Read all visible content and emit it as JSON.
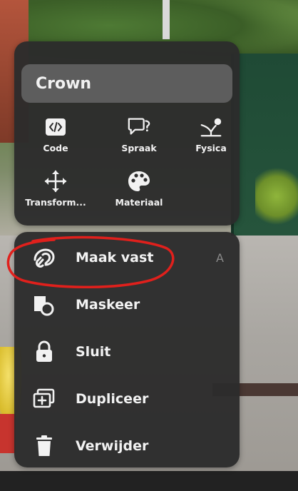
{
  "panel": {
    "title": "Crown"
  },
  "tools": [
    {
      "label": "Code",
      "icon": "code-icon"
    },
    {
      "label": "Spraak",
      "icon": "speech-bubble-icon"
    },
    {
      "label": "Fysica",
      "icon": "physics-icon"
    },
    {
      "label": "Transform...",
      "icon": "move-arrows-icon"
    },
    {
      "label": "Materiaal",
      "icon": "palette-icon"
    }
  ],
  "menu": [
    {
      "label": "Maak vast",
      "shortcut": "A",
      "icon": "attach-icon"
    },
    {
      "label": "Maskeer",
      "icon": "mask-icon"
    },
    {
      "label": "Sluit",
      "icon": "lock-icon"
    },
    {
      "label": "Dupliceer",
      "icon": "duplicate-icon"
    },
    {
      "label": "Verwijder",
      "icon": "trash-icon"
    }
  ],
  "colors": {
    "panel_bg": "#2c2c2c",
    "title_bg": "#5d5d5d",
    "text": "#f2f2f2",
    "shortcut_text": "#8a8a8a",
    "annotation": "#e0201c"
  }
}
